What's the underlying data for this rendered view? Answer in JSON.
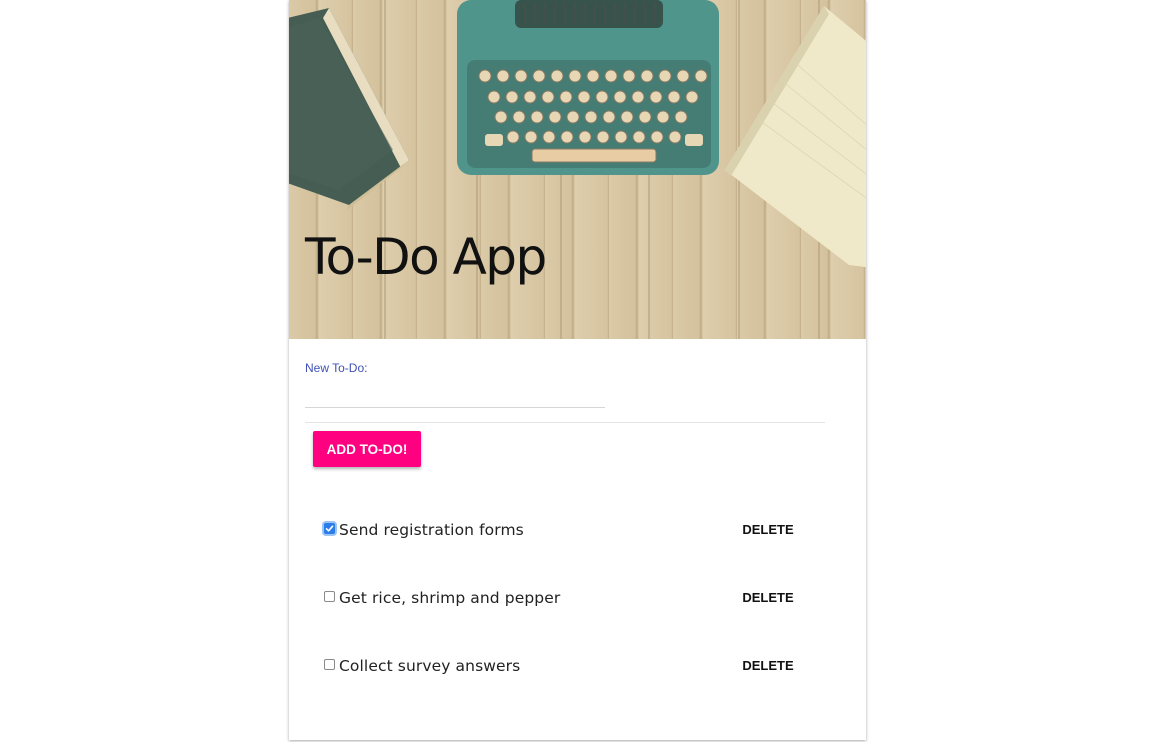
{
  "header": {
    "title": "To-Do App",
    "image_icon": "typewriter-desk-image"
  },
  "form": {
    "label": "New To-Do:",
    "value": "",
    "add_label": "ADD TO-DO!"
  },
  "todos": [
    {
      "text": "Send registration forms",
      "done": true,
      "delete_label": "DELETE"
    },
    {
      "text": "Get rice, shrimp and pepper",
      "done": false,
      "delete_label": "DELETE"
    },
    {
      "text": "Collect survey answers",
      "done": false,
      "delete_label": "DELETE"
    }
  ],
  "colors": {
    "accent": "#ff0080",
    "label": "#3f51b5",
    "checkbox": "#2b7de9"
  }
}
